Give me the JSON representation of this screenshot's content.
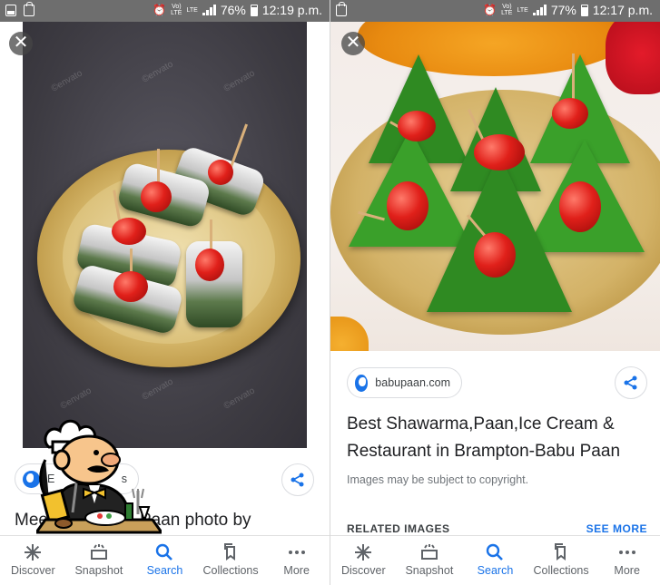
{
  "status_left": {
    "icons": [
      "image-icon",
      "bag-icon"
    ],
    "alarm_icon": "alarm-icon",
    "network_label_top": "Vo)",
    "network_label_bottom": "LTE",
    "lte2_top": "LTE",
    "battery_percent": "76%",
    "time": "12:19 p.m."
  },
  "status_right": {
    "network_label_top": "Vo)",
    "network_label_bottom": "LTE",
    "lte2_top": "LTE",
    "battery_percent": "77%",
    "time": "12:17 p.m."
  },
  "left_panel": {
    "close_label": "✕",
    "watermark": "©envato",
    "source_chip": {
      "text_prefix": "E",
      "text_suffix": "s"
    },
    "result_title_start": "Mee",
    "result_title_end": "Paan photo by"
  },
  "right_panel": {
    "close_label": "✕",
    "source_chip": {
      "text": "babupaan.com"
    },
    "result_title": "Best Shawarma,Paan,Ice Cream & Restaurant in Brampton-Babu Paan",
    "copyright_note": "Images may be subject to copyright.",
    "related_label": "RELATED IMAGES",
    "see_more_label": "SEE MORE"
  },
  "bottom_nav": [
    {
      "label": "Discover",
      "icon": "asterisk-icon",
      "active": false
    },
    {
      "label": "Snapshot",
      "icon": "snapshot-icon",
      "active": false
    },
    {
      "label": "Search",
      "icon": "search-icon",
      "active": true
    },
    {
      "label": "Collections",
      "icon": "bookmark-icon",
      "active": false
    },
    {
      "label": "More",
      "icon": "more-dots-icon",
      "active": false
    }
  ],
  "colors": {
    "accent": "#1a73e8",
    "status_bar": "#6e6e6e",
    "text_primary": "#202124",
    "text_secondary": "#70757a"
  }
}
